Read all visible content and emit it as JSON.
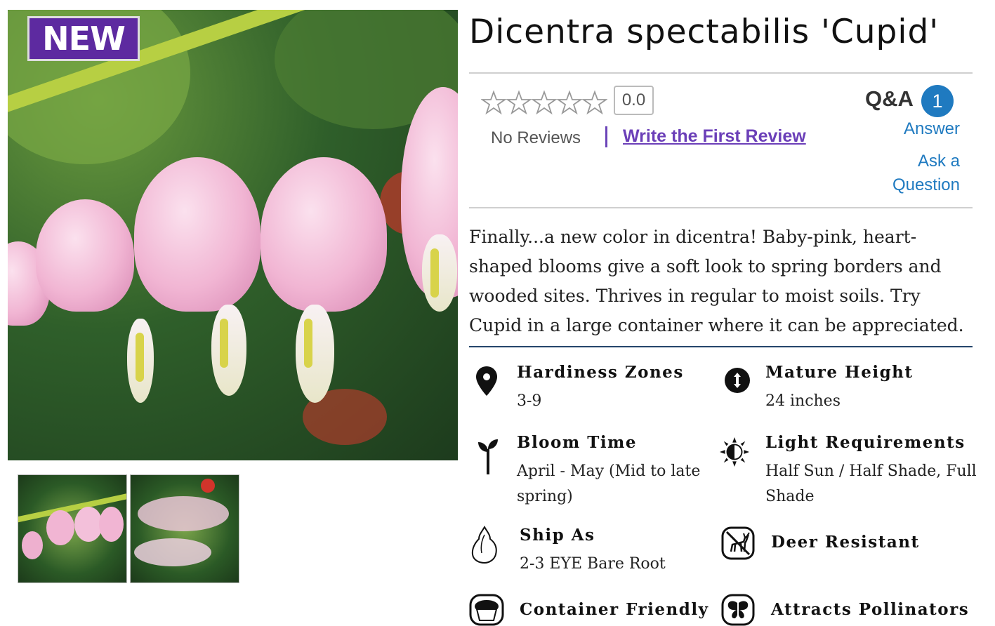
{
  "product": {
    "badge": "NEW",
    "title": "Dicentra spectabilis 'Cupid'",
    "description": "Finally...a new color in dicentra! Baby-pink, heart-shaped blooms give a soft look to spring borders and wooded sites. Thrives in regular to moist soils. Try Cupid in a large container where it can be appreciated."
  },
  "reviews": {
    "stars_filled": 0,
    "stars_total": 5,
    "rating": "0.0",
    "no_reviews": "No Reviews",
    "write_review": "Write the First Review"
  },
  "qa": {
    "label": "Q&A",
    "count": "1",
    "answer": "Answer",
    "ask_line1": "Ask a",
    "ask_line2": "Question"
  },
  "attributes": {
    "hardiness": {
      "label": "Hardiness Zones",
      "value": "3-9",
      "icon": "map-pin-icon"
    },
    "height": {
      "label": "Mature Height",
      "value": "24 inches",
      "icon": "height-arrows-icon"
    },
    "bloom": {
      "label": "Bloom Time",
      "value_line1": "April - May (Mid to late",
      "value_line2": "spring)",
      "icon": "sprout-icon"
    },
    "light": {
      "label": "Light Requirements",
      "value_line1": "Half Sun / Half Shade, Full",
      "value_line2": "Shade",
      "icon": "half-sun-icon"
    },
    "ship": {
      "label": "Ship As",
      "value": "2-3 EYE Bare Root",
      "icon": "bulb-root-icon"
    },
    "deer": {
      "label": "Deer Resistant",
      "icon": "deer-icon"
    },
    "container": {
      "label": "Container Friendly",
      "icon": "pot-icon"
    },
    "pollinators": {
      "label": "Attracts Pollinators",
      "icon": "butterfly-icon"
    }
  },
  "colors": {
    "badge_bg": "#5d2aa0",
    "link_purple": "#6b3fb8",
    "link_blue": "#1f7ac0",
    "rule_dark": "#25466b"
  }
}
